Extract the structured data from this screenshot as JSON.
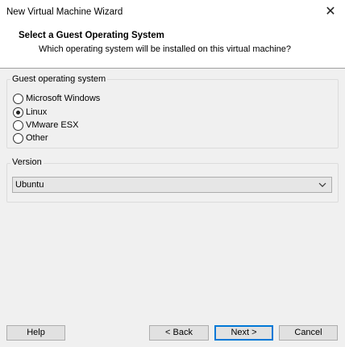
{
  "window": {
    "title": "New Virtual Machine Wizard"
  },
  "header": {
    "title": "Select a Guest Operating System",
    "subtitle": "Which operating system will be installed on this virtual machine?"
  },
  "guest_os": {
    "label": "Guest operating system",
    "options": [
      {
        "label": "Microsoft Windows",
        "checked": false
      },
      {
        "label": "Linux",
        "checked": true
      },
      {
        "label": "VMware ESX",
        "checked": false
      },
      {
        "label": "Other",
        "checked": false
      }
    ]
  },
  "version": {
    "label": "Version",
    "selected": "Ubuntu"
  },
  "buttons": {
    "help": "Help",
    "back": "< Back",
    "next": "Next >",
    "cancel": "Cancel"
  },
  "icons": {
    "close": "close-icon",
    "dropdown": "chevron-down-icon"
  }
}
